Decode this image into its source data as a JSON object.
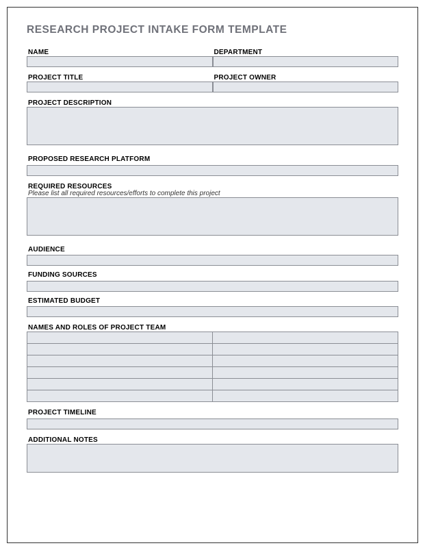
{
  "title": "RESEARCH PROJECT INTAKE FORM TEMPLATE",
  "labels": {
    "name": "NAME",
    "department": "DEPARTMENT",
    "projectTitle": "PROJECT TITLE",
    "projectOwner": "PROJECT OWNER",
    "projectDescription": "PROJECT DESCRIPTION",
    "proposedPlatform": "PROPOSED RESEARCH PLATFORM",
    "requiredResources": "REQUIRED RESOURCES",
    "requiredResourcesSub": "Please list all required resources/efforts to complete this project",
    "audience": "AUDIENCE",
    "fundingSources": "FUNDING SOURCES",
    "estimatedBudget": "ESTIMATED BUDGET",
    "teamNamesRoles": "NAMES AND ROLES OF PROJECT TEAM",
    "projectTimeline": "PROJECT TIMELINE",
    "additionalNotes": "ADDITIONAL NOTES"
  },
  "values": {
    "name": "",
    "department": "",
    "projectTitle": "",
    "projectOwner": "",
    "projectDescription": "",
    "proposedPlatform": "",
    "requiredResources": "",
    "audience": "",
    "fundingSources": "",
    "estimatedBudget": "",
    "projectTimeline": "",
    "additionalNotes": "",
    "team": [
      {
        "name": "",
        "role": ""
      },
      {
        "name": "",
        "role": ""
      },
      {
        "name": "",
        "role": ""
      },
      {
        "name": "",
        "role": ""
      },
      {
        "name": "",
        "role": ""
      },
      {
        "name": "",
        "role": ""
      }
    ]
  }
}
